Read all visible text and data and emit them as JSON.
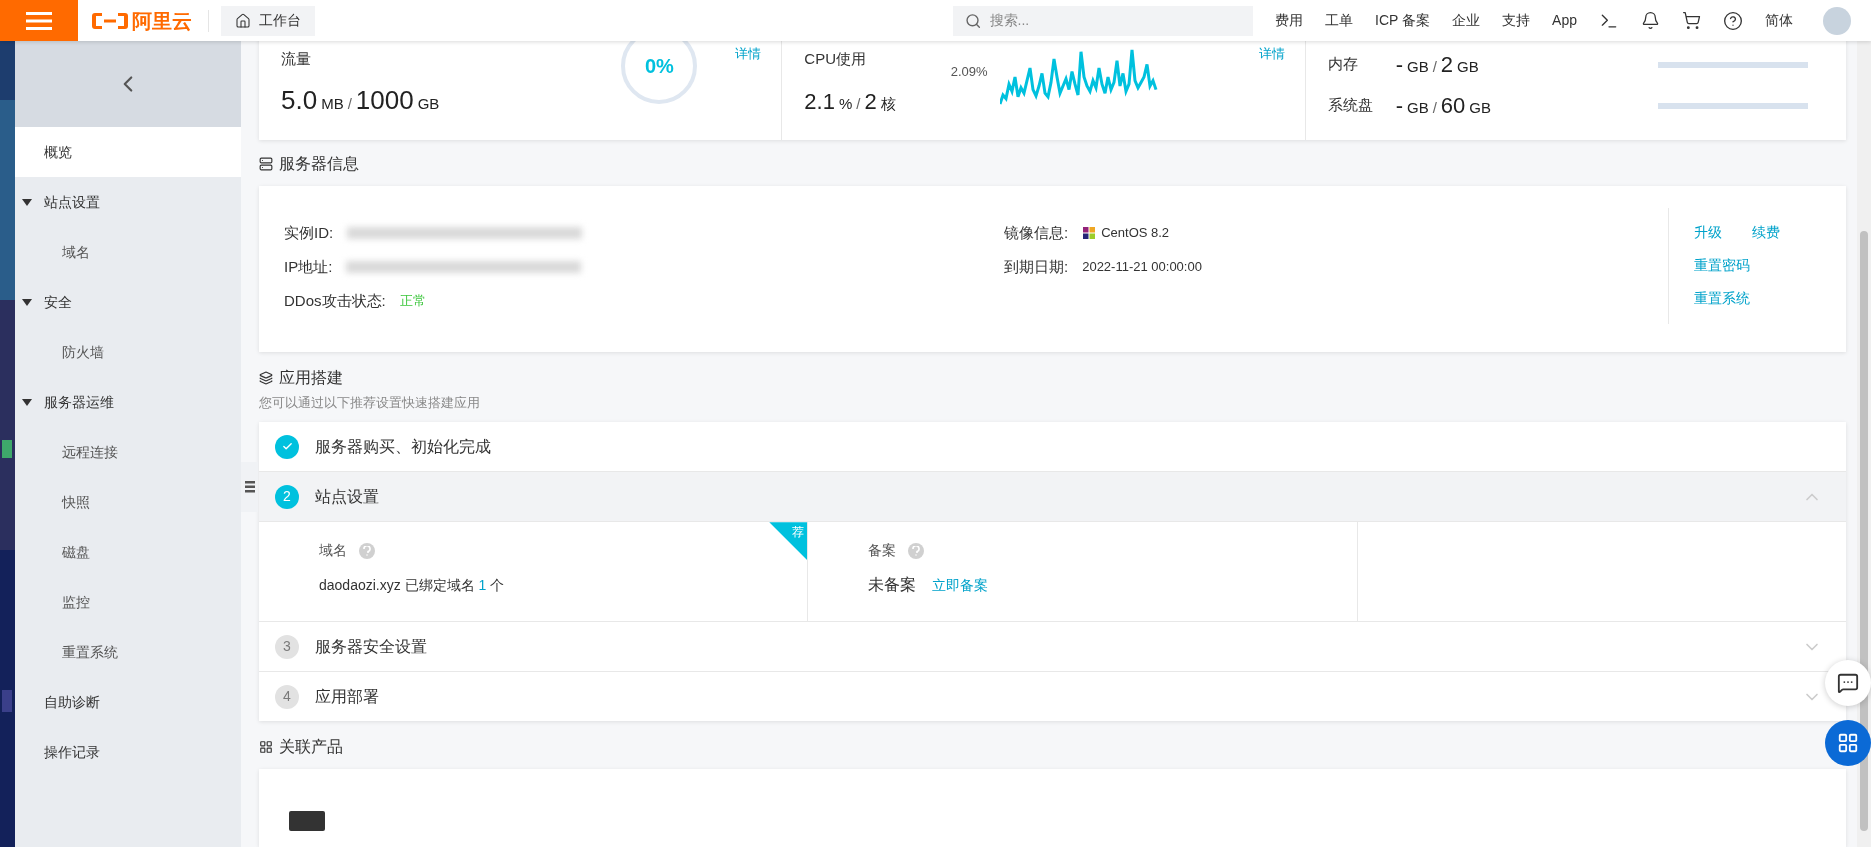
{
  "header": {
    "logo_text": "阿里云",
    "workbench": "工作台",
    "search_placeholder": "搜索...",
    "nav": [
      "费用",
      "工单",
      "ICP 备案",
      "企业",
      "支持",
      "App"
    ],
    "language": "简体"
  },
  "sidebar": {
    "items": [
      {
        "label": "概览",
        "selected": true
      },
      {
        "label": "站点设置",
        "selected": false,
        "expanded": true,
        "children": [
          {
            "label": "域名",
            "selected": false
          }
        ]
      },
      {
        "label": "安全",
        "selected": false,
        "expanded": true,
        "children": [
          {
            "label": "防火墙",
            "selected": false
          }
        ]
      },
      {
        "label": "服务器运维",
        "selected": false,
        "expanded": true,
        "children": [
          {
            "label": "远程连接",
            "selected": false
          },
          {
            "label": "快照",
            "selected": false
          },
          {
            "label": "磁盘",
            "selected": false
          },
          {
            "label": "监控",
            "selected": false
          },
          {
            "label": "重置系统",
            "selected": false
          }
        ]
      },
      {
        "label": "自助诊断",
        "selected": false
      },
      {
        "label": "操作记录",
        "selected": false
      }
    ]
  },
  "usage_cards": [
    {
      "kind": "gauge",
      "label": "流量",
      "value": "5.0",
      "unit": "MB",
      "separator": "/",
      "total": "1000",
      "total_unit": "GB",
      "gauge_text": "0%",
      "link": "详情"
    },
    {
      "kind": "sparkline",
      "label": "CPU使用",
      "value": "2.1",
      "unit": "%",
      "separator": "/",
      "total": "2",
      "total_unit": "核",
      "peak_label": "2.09%",
      "link": "详情"
    },
    {
      "kind": "bars",
      "rows": [
        {
          "label": "内存",
          "value": "-",
          "unit": "GB",
          "separator": "/",
          "total": "2",
          "total_unit": "GB"
        },
        {
          "label": "系统盘",
          "value": "-",
          "unit": "GB",
          "separator": "/",
          "total": "60",
          "total_unit": "GB"
        }
      ]
    }
  ],
  "server_info": {
    "title": "服务器信息",
    "left_fields": [
      {
        "kind": "redacted",
        "label": "实例ID:"
      },
      {
        "kind": "redacted",
        "label": "IP地址:"
      },
      {
        "kind": "status",
        "label": "DDos攻击状态:",
        "value": "正常"
      }
    ],
    "right_fields": [
      {
        "kind": "os",
        "label": "镜像信息:",
        "value": "CentOS 8.2"
      },
      {
        "kind": "text",
        "label": "到期日期:",
        "value": "2022-11-21 00:00:00"
      }
    ],
    "actions": [
      [
        "升级",
        "续费"
      ],
      [
        "重置密码"
      ],
      [
        "重置系统"
      ]
    ]
  },
  "app_build": {
    "title": "应用搭建",
    "subtitle": "您可以通过以下推荐设置快速搭建应用",
    "steps": [
      {
        "kind": "done",
        "label": "服务器购买、初始化完成",
        "expanded": false
      },
      {
        "kind": "active",
        "number": "2",
        "label": "站点设置",
        "expanded": true
      },
      {
        "kind": "pending",
        "number": "3",
        "label": "服务器安全设置",
        "expanded": false
      },
      {
        "kind": "pending",
        "number": "4",
        "label": "应用部署",
        "expanded": false
      }
    ],
    "site_detail": {
      "domain": {
        "label": "域名",
        "ribbon": "荐",
        "value": "daodaozi.xyz 已绑定域名",
        "count": "1",
        "count_suffix": "个"
      },
      "record": {
        "label": "备案",
        "value": "未备案",
        "link": "立即备案"
      }
    }
  },
  "related": {
    "title": "关联产品"
  }
}
